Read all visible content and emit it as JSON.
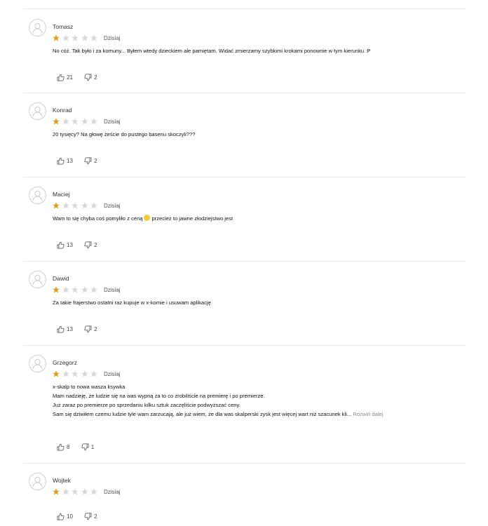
{
  "colors": {
    "star_filled": "#e0a21a",
    "star_empty": "#d8d8d8",
    "divider": "#ececec",
    "more_link": "#888888"
  },
  "icons": {
    "avatar": "user-avatar-icon",
    "like": "thumbs-up-icon",
    "dislike": "thumbs-down-icon",
    "star": "star-icon"
  },
  "reviews": [
    {
      "name": "Tomasz",
      "rating": 1,
      "date": "Dzisiaj",
      "lines": [
        "No cóż. Tak było i za komuny... Byłem wtedy dzieckiem ale pamiętam. Widać zmierzamy szybkimi krokami ponownie w tym kierunku :P"
      ],
      "likes": "21",
      "dislikes": "2"
    },
    {
      "name": "Konrad",
      "rating": 1,
      "date": "Dzisiaj",
      "lines": [
        "20 tysięcy? Na głowę żeście do pustego basenu skoczyli???"
      ],
      "likes": "13",
      "dislikes": "2"
    },
    {
      "name": "Maciej",
      "rating": 1,
      "date": "Dzisiaj",
      "lines": [
        "Wam to się chyba coś pomyliło z ceną",
        "przecież to jawne złodziejstwo jest"
      ],
      "likes": "13",
      "dislikes": "2"
    },
    {
      "name": "Dawid",
      "rating": 1,
      "date": "Dzisiaj",
      "lines": [
        "Za takie frajerstwo ostatni raz kupuje w x-komie i usuwam aplikację"
      ],
      "likes": "13",
      "dislikes": "2"
    },
    {
      "name": "Grzegorz",
      "rating": 1,
      "date": "Dzisiaj",
      "lines": [
        "x-skalp to nowa wasza ksywka",
        "Mam nadzieję, że ludzie się na was wypną za to co zrobiliście na premierę i po premierze.",
        "Już zaraz po premierze po sprzedaniu kilku sztuk zaczęliście podwyższać ceny.",
        "Sam się dziwiłem czemu ludzie tyle wam zarzucają, ale już wiem, że dla was skalperski zysk jest więcej wart niż szacunek kli..."
      ],
      "more_label": "Rozwiń dalej",
      "likes": "8",
      "dislikes": "1"
    },
    {
      "name": "Wojtek",
      "rating": 1,
      "date": "Dzisiaj",
      "lines": [],
      "likes": "10",
      "dislikes": "2"
    }
  ]
}
